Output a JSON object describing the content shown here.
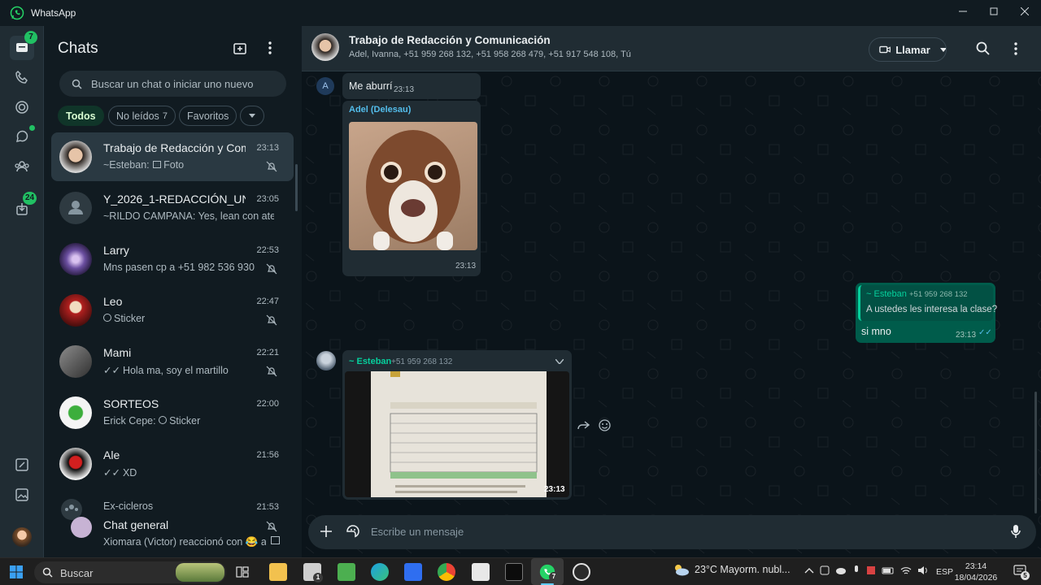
{
  "window": {
    "title": "WhatsApp",
    "minimize_icon": "minimize-icon",
    "maximize_icon": "maximize-icon",
    "close_icon": "close-icon"
  },
  "rail": {
    "chats_badge": "7",
    "status_dot": true,
    "downloads_badge": "24"
  },
  "chatlist": {
    "title": "Chats",
    "search_placeholder": "Buscar un chat o iniciar uno nuevo",
    "filters": [
      {
        "label": "Todos",
        "count": ""
      },
      {
        "label": "No leídos",
        "count": "7"
      },
      {
        "label": "Favoritos",
        "count": ""
      }
    ],
    "chats": [
      {
        "name": "Trabajo de Redacción y Com...",
        "preview": "~Esteban: ",
        "preview_media": "Foto",
        "time": "23:13",
        "muted": true
      },
      {
        "name": "Y_2026_1-REDACCIÓN_UNI_...",
        "preview": "~RILDO CAMPANA: Yes, lean con aten...",
        "time": "23:05",
        "muted": false
      },
      {
        "name": "Larry",
        "preview": "Mns pasen cp a +51 982 536 930",
        "time": "22:53",
        "muted": true
      },
      {
        "name": "Leo",
        "preview": "Sticker",
        "time": "22:47",
        "muted": true
      },
      {
        "name": "Mami",
        "preview": "Hola ma, soy el martillo",
        "time": "22:21",
        "muted": true
      },
      {
        "name": "SORTEOS",
        "preview": "Erick Cepe: ",
        "preview_media": "Sticker",
        "time": "22:00",
        "muted": false
      },
      {
        "name": "Ale",
        "preview": "XD",
        "time": "21:56",
        "muted": false
      },
      {
        "community": "Ex-cicleros",
        "name": "Chat general",
        "preview": "Xiomara (Victor) reaccionó con 😂 a: \"",
        "time": "21:53",
        "muted": true
      }
    ]
  },
  "conversation": {
    "title": "Trabajo de Redacción y Comunicación",
    "members": "Adel, Ivanna, +51 959 268 132, +51 958 268 479, +51 917 548 108, Tú",
    "call_label": "Llamar",
    "messages": {
      "m1": {
        "avatar_letter": "A",
        "text": "Me aburrí",
        "time": "23:13"
      },
      "m2": {
        "sender": "Adel (Delesau)",
        "time": "23:13"
      },
      "m3": {
        "quote_sender": "~ Esteban",
        "quote_phone": "+51 959 268 132",
        "quote_text": "A ustedes les interesa la clase?",
        "text": "si mno",
        "time": "23:13"
      },
      "m4": {
        "sender": "~ Esteban",
        "phone": "+51 959 268 132",
        "time": "23:13"
      }
    },
    "composer_placeholder": "Escribe un mensaje"
  },
  "taskbar": {
    "search_label": "Buscar",
    "weather": "23°C  Mayorm. nubl...",
    "language": "ESP",
    "time": "23:14",
    "date": "18/04/2026",
    "whatsapp_badge": "7",
    "explorer_badge": "1",
    "notifications": "5"
  },
  "colors": {
    "accent": "#21c063",
    "outgoing": "#005c4b",
    "incoming": "#202c33",
    "link_green": "#53bdeb"
  }
}
